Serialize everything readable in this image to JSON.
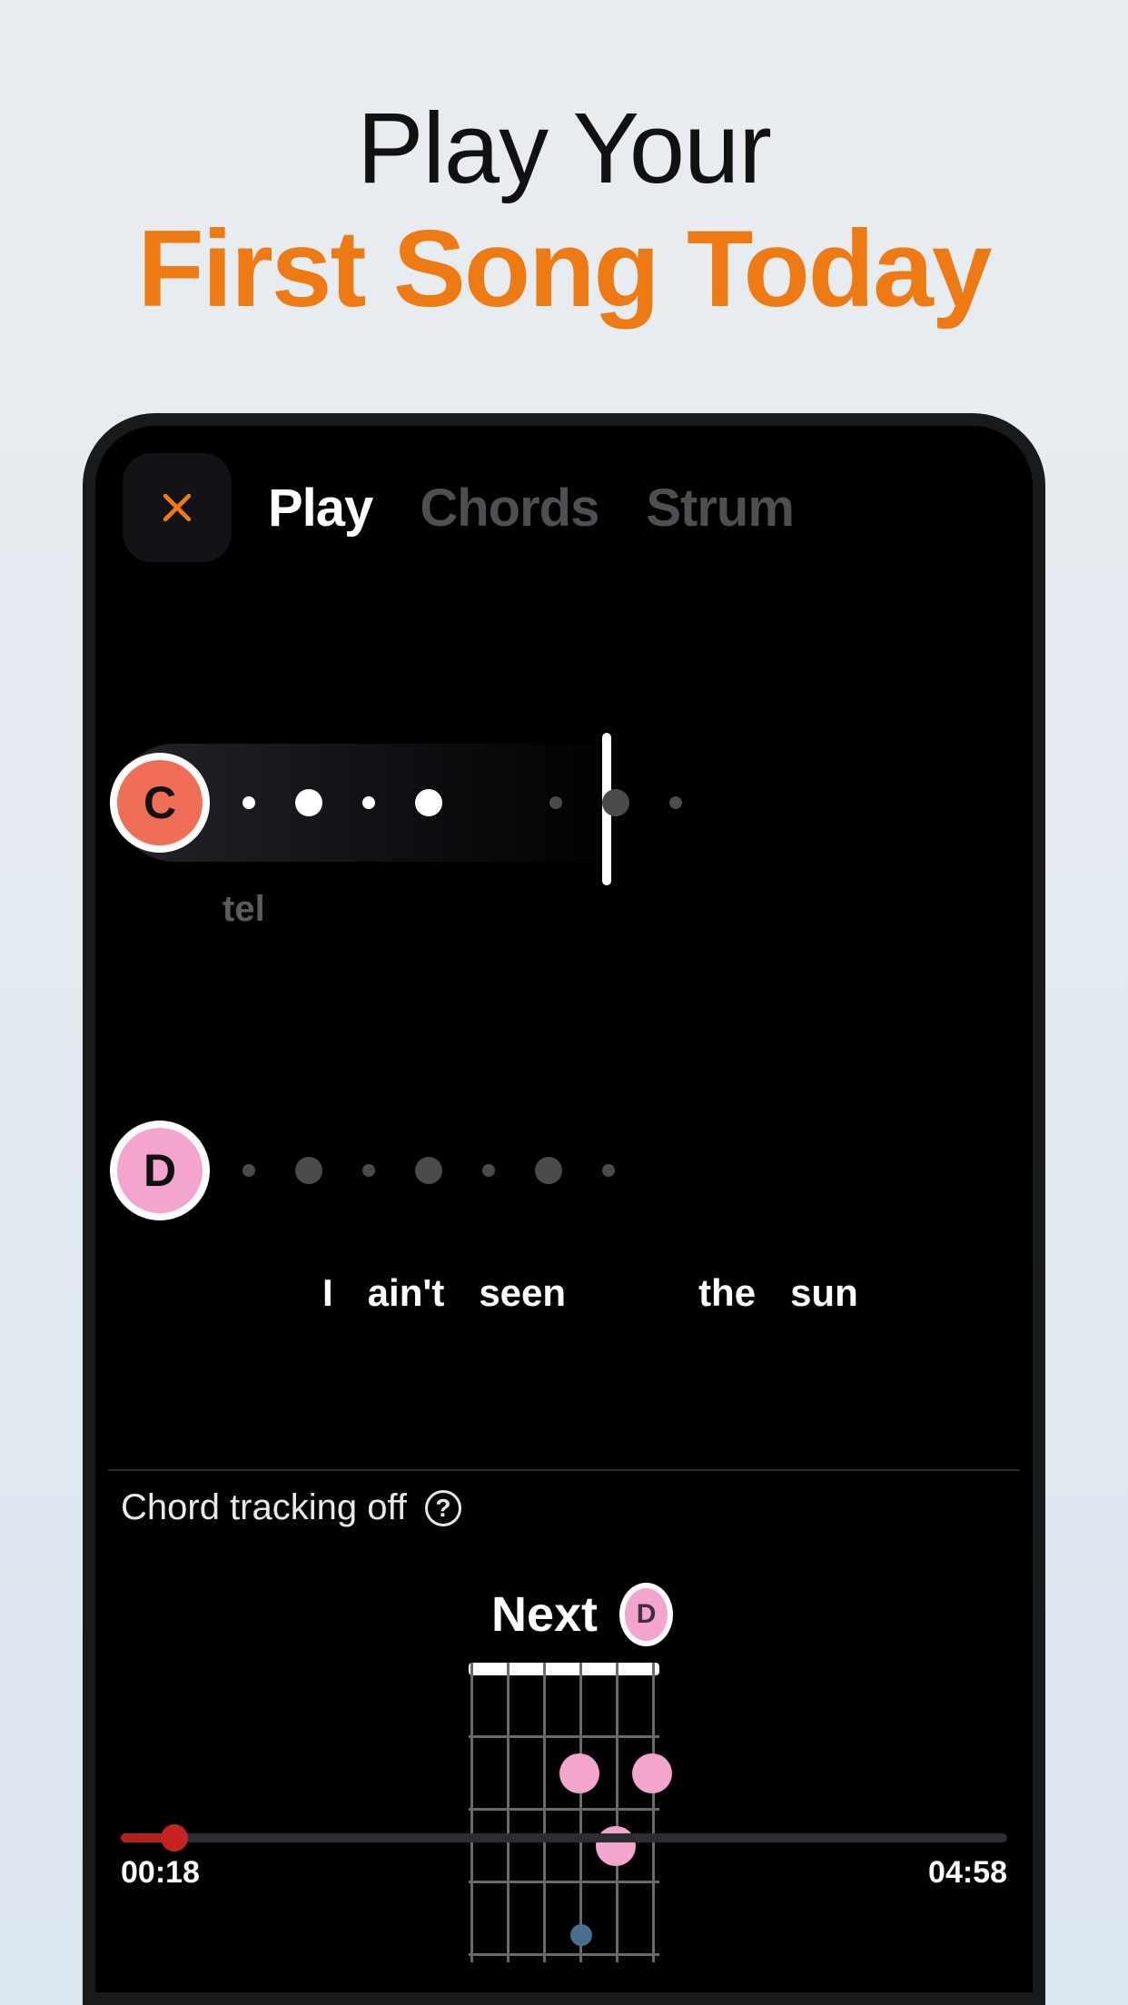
{
  "promo": {
    "line1": "Play Your",
    "line2": "First Song Today"
  },
  "topbar": {
    "close_icon": "close",
    "tabs": {
      "play": "Play",
      "chords": "Chords",
      "strum": "Strum"
    }
  },
  "lane1": {
    "chord": "C",
    "lyric_fragment": "tel"
  },
  "lane2": {
    "chord": "D",
    "lyrics": [
      "I",
      "ain't",
      "seen",
      "the",
      "sun"
    ]
  },
  "tracking": {
    "label": "Chord tracking off",
    "help": "?"
  },
  "next": {
    "label": "Next",
    "chord": "D"
  },
  "playback": {
    "elapsed": "00:18",
    "duration": "04:58",
    "progress_pct": 6
  }
}
